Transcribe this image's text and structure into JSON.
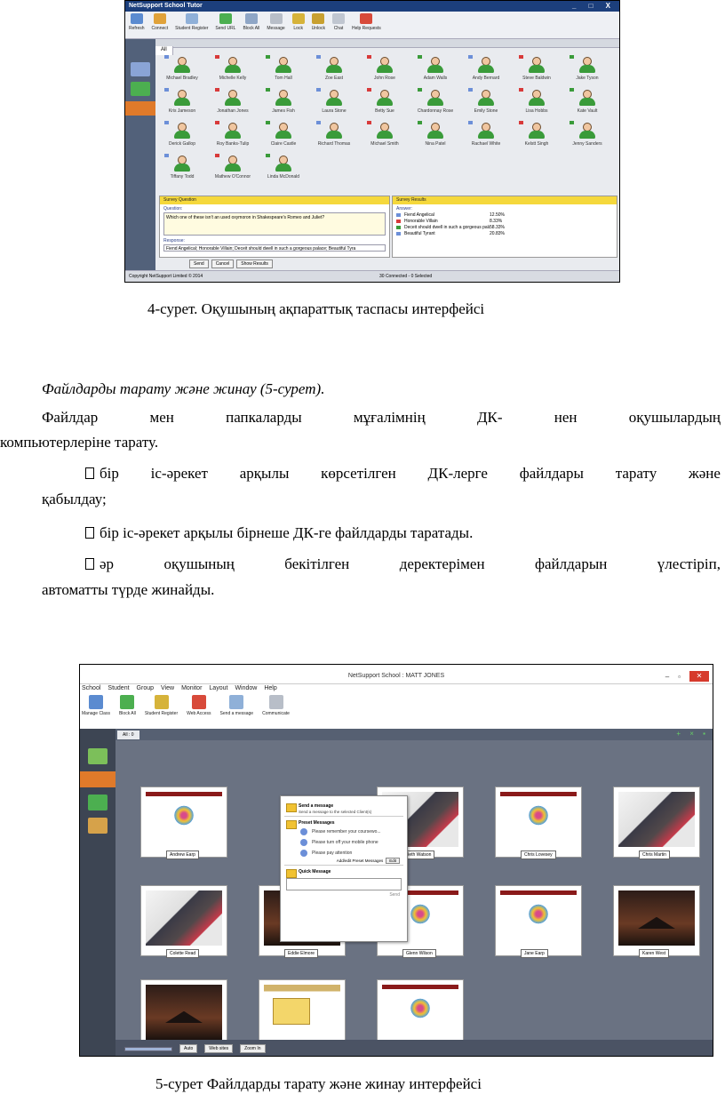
{
  "screen1": {
    "title": "NetSupport School Tutor",
    "window_controls": "_ □ X",
    "toolbar": [
      "Refresh",
      "Connect",
      "Student Register",
      "Send URL",
      "Block All",
      "Message",
      "Lock",
      "Unlock",
      "Chat",
      "Help Requests"
    ],
    "tab_all": "All",
    "students": [
      "Michael Bradley",
      "Michelle Kelly",
      "Tom Hall",
      "Zoe East",
      "John Rose",
      "Adam Walls",
      "Andy Bernard",
      "Steve Baldwin",
      "Jake Tyson",
      "Kris Jameson",
      "Jonathan Jones",
      "James Fish",
      "Laura Stone",
      "Betty Sue",
      "Chardonnay Rose",
      "Emily Stone",
      "Lisa Hobbs",
      "Kate Vault",
      "Derick Gallop",
      "Roy Banks-Tulip",
      "Claire Castle",
      "Richard Thomas",
      "Michael Smith",
      "Nina Patel",
      "Rachael White",
      "Kelstt Singh",
      "Jenny Sanders",
      "Tiffany Todd",
      "Mathew O'Connor",
      "Linda McDonald"
    ],
    "survey_question_title": "Survey Question",
    "question_label": "Question:",
    "question_text": "Which one of these isn't an used oxymoron in Shakespeare's Romeo and Juliet?",
    "response_label": "Response:",
    "response_text": "Fiend Angelical; Honorable Villain; Deceit should dwell in such a gorgeous palace; Beautiful Tyra",
    "buttons": [
      "Send",
      "Cancel",
      "Show Results"
    ],
    "survey_results_title": "Survey Results",
    "answer_label": "Answer:",
    "answers": [
      {
        "text": "Fiend Angelical",
        "pct": "12.50%"
      },
      {
        "text": "Honorable Villain",
        "pct": "8.33%"
      },
      {
        "text": "Deceit should dwell in such a gorgeous palace",
        "pct": "58.33%"
      },
      {
        "text": "Beautiful Tyrant",
        "pct": "20.83%"
      }
    ],
    "status_left": "Copyright NetSupport Limited © 2014",
    "status_right": "30 Connected - 0 Selected"
  },
  "caption1": "4-сурет. Оқушының ақпараттық таспасы интерфейсі",
  "heading": "Файлдарды тарату және жинау (5-сурет).",
  "para1_words": [
    "Файлдар",
    "мен",
    "папкаларды",
    "мұғалімнің",
    "ДК-",
    "нен",
    "оқушылардың"
  ],
  "para1_line2": "компьютерлеріне тарату.",
  "bullet1_words": [
    "бір",
    "іс-әрекет",
    "арқылы",
    "көрсетілген",
    "ДК-лерге",
    "файлдары",
    "тарату",
    "және"
  ],
  "bullet1_line2": "қабылдау;",
  "bullet2": "бір іс-әрекет арқылы бірнеше ДК-ге файлдарды таратады.",
  "bullet3_words": [
    "әр",
    "оқушының",
    "бекітілген",
    "деректерімен",
    "файлдарын",
    "үлестіріп,"
  ],
  "bullet3_line2": "автоматты түрде жинайды.",
  "screen2": {
    "title": "NetSupport School : MATT JONES",
    "menu": [
      "School",
      "Student",
      "Group",
      "View",
      "Monitor",
      "Layout",
      "Window",
      "Help"
    ],
    "toolbar": [
      "Manage Class",
      "Block All",
      "Student Register",
      "Web Access",
      "Send a message",
      "Communicate"
    ],
    "tab_all": "All : 0",
    "thumbs": [
      {
        "name": "Andrew Earp",
        "kind": "web"
      },
      {
        "name": "Beth Watson",
        "kind": "photo"
      },
      {
        "name": "Chris Lovesey",
        "kind": "web"
      },
      {
        "name": "Chris Martin",
        "kind": "photo"
      },
      {
        "name": "Colette Read",
        "kind": "photo"
      },
      {
        "name": "Eddie Elmore",
        "kind": "dark"
      },
      {
        "name": "Glenn Wilson",
        "kind": "web"
      },
      {
        "name": "Jane Earp",
        "kind": "web"
      },
      {
        "name": "Karen West",
        "kind": "dark"
      },
      {
        "name": "Lisa Brown",
        "kind": "dark"
      },
      {
        "name": "Liz Bury",
        "kind": "gold"
      },
      {
        "name": "Rebecca Davies",
        "kind": "web"
      }
    ],
    "popup": {
      "send_title": "Send a message",
      "send_sub": "Send a message to the selected Client(s)",
      "preset_title": "Preset Messages",
      "presets": [
        "Please remember your coursewo...",
        "Please turn off your mobile phone",
        "Please pay attention"
      ],
      "add_edit": "Add/edit Preset Messages",
      "edit": "Edit",
      "quick_title": "Quick Message",
      "send": "Send"
    },
    "bottom": [
      "Auto",
      "Web sites",
      "Zoom In"
    ]
  },
  "caption2": "5-сурет Файлдарды тарату және жинау интерфейсі",
  "colors": {
    "title_blue": "#1c3f7c",
    "survey_yellow": "#f5d83c",
    "flags": [
      "#6c8fd8",
      "#d83a3a",
      "#3a9b3a"
    ]
  }
}
